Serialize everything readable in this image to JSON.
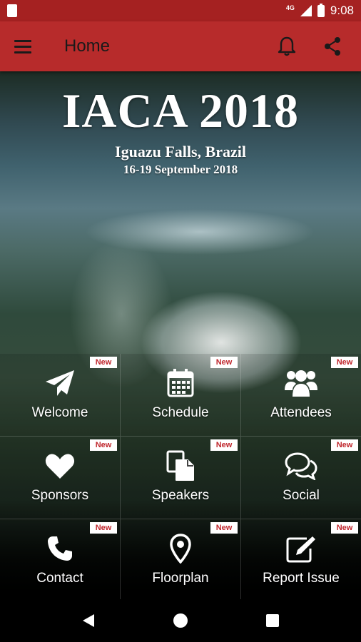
{
  "status_bar": {
    "time": "9:08",
    "network": "4G",
    "icons": [
      "sd-card-icon",
      "signal-icon",
      "battery-icon"
    ]
  },
  "toolbar": {
    "title": "Home",
    "icons": [
      "menu-icon",
      "bell-icon",
      "share-icon"
    ]
  },
  "hero": {
    "title": "IACA 2018",
    "location": "Iguazu Falls, Brazil",
    "dates": "16-19 September 2018"
  },
  "grid": {
    "badge_label": "New",
    "tiles": [
      {
        "label": "Welcome",
        "icon": "paper-plane-icon"
      },
      {
        "label": "Schedule",
        "icon": "calendar-icon"
      },
      {
        "label": "Attendees",
        "icon": "users-icon"
      },
      {
        "label": "Sponsors",
        "icon": "heart-icon"
      },
      {
        "label": "Speakers",
        "icon": "documents-icon"
      },
      {
        "label": "Social",
        "icon": "chat-bubbles-icon"
      },
      {
        "label": "Contact",
        "icon": "phone-icon"
      },
      {
        "label": "Floorplan",
        "icon": "map-marker-icon"
      },
      {
        "label": "Report Issue",
        "icon": "edit-icon"
      }
    ]
  },
  "nav": {
    "icons": [
      "back-icon",
      "home-icon",
      "recents-icon"
    ]
  },
  "colors": {
    "status_bar": "#a52121",
    "toolbar": "#b72b2b",
    "badge_text": "#c0272d"
  }
}
